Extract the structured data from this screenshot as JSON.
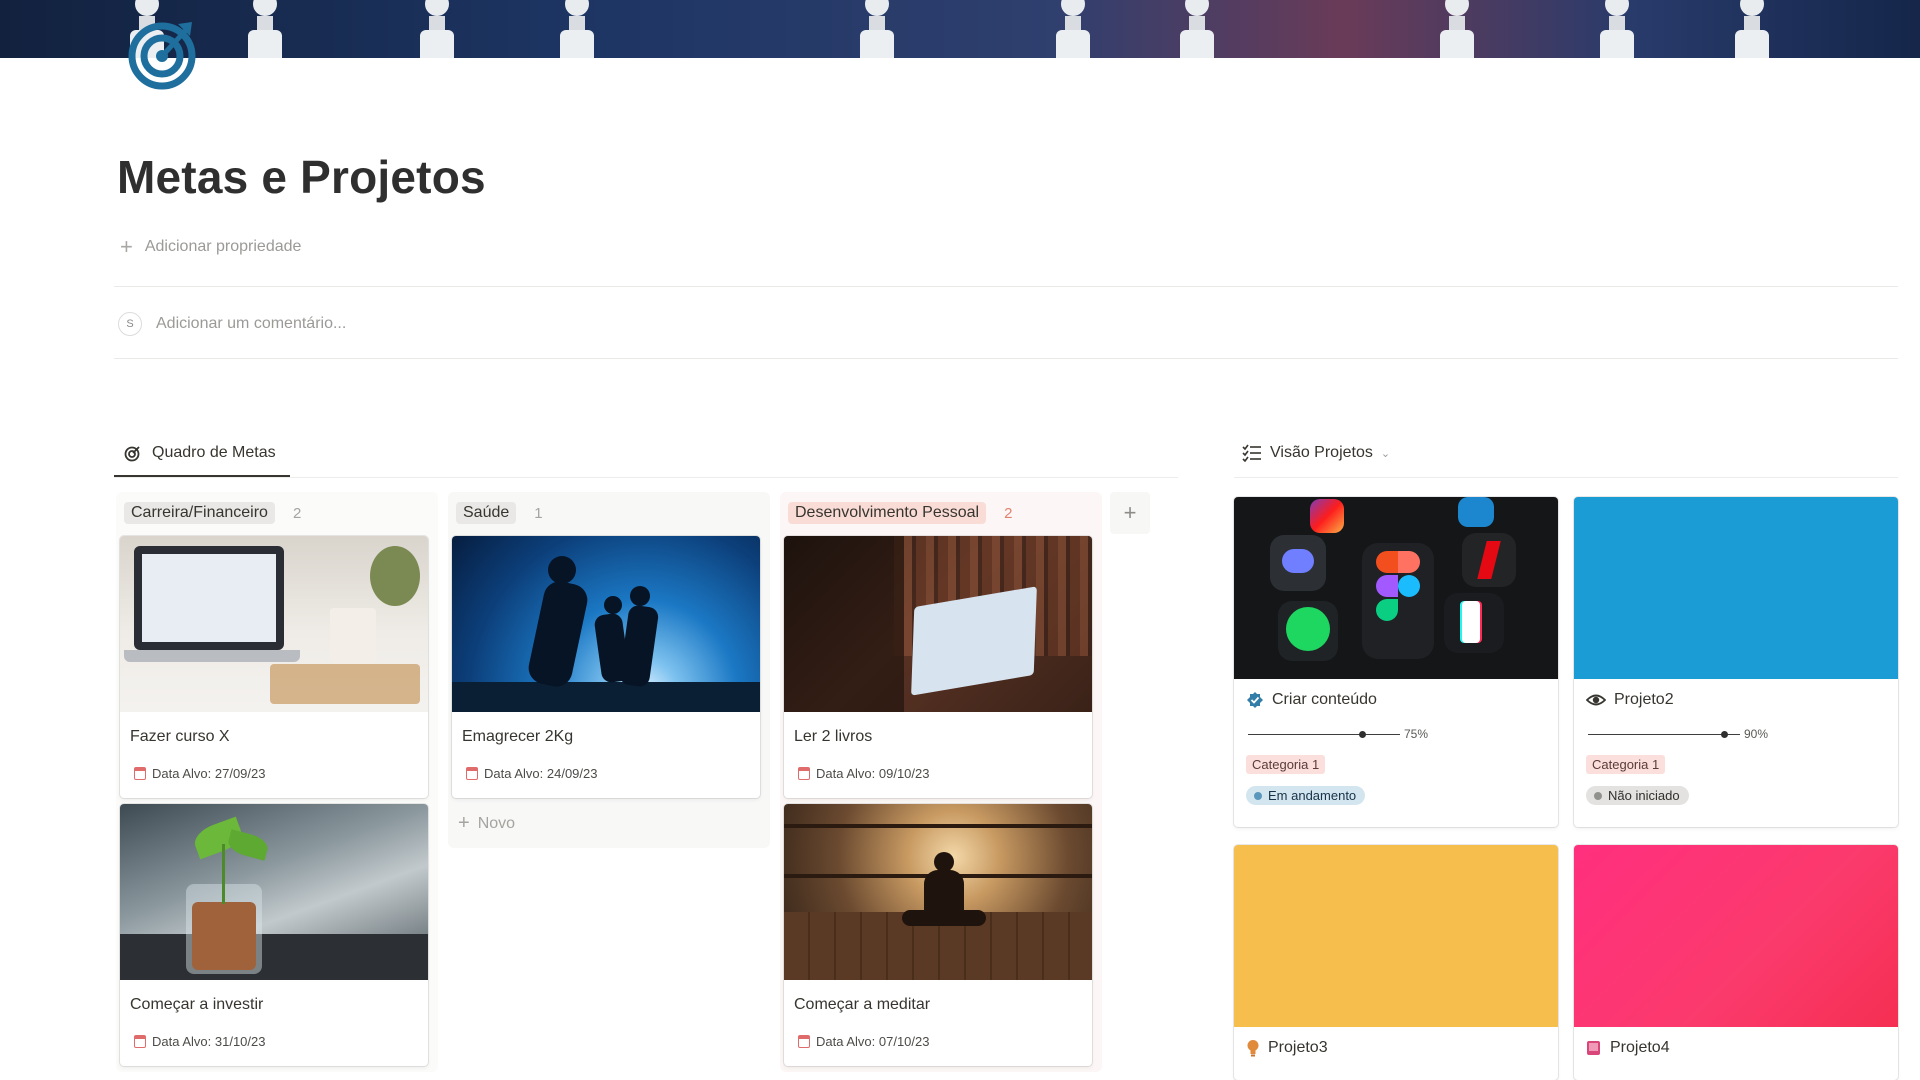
{
  "page": {
    "title": "Metas e Projetos",
    "add_property": "Adicionar propriedade",
    "comment_placeholder": "Adicionar um comentário...",
    "comment_avatar": "S"
  },
  "board": {
    "view_name": "Quadro de Metas",
    "new_label": "Novo",
    "add_group_label": "+",
    "groups": [
      {
        "name": "Carreira/Financeiro",
        "count": "2",
        "tag_color": "#e9e8e6",
        "cards": [
          {
            "title": "Fazer curso X",
            "date": "Data Alvo: 27/09/23"
          },
          {
            "title": "Começar a investir",
            "date": "Data Alvo: 31/10/23"
          }
        ]
      },
      {
        "name": "Saúde",
        "count": "1",
        "tag_color": "#e9e8e6",
        "cards": [
          {
            "title": "Emagrecer 2Kg",
            "date": "Data Alvo: 24/09/23"
          }
        ]
      },
      {
        "name": "Desenvolvimento Pessoal",
        "count": "2",
        "tag_color": "#fadcd7",
        "cards": [
          {
            "title": "Ler 2 livros",
            "date": "Data Alvo: 09/10/23"
          },
          {
            "title": "Começar a meditar",
            "date": "Data Alvo: 07/10/23"
          }
        ]
      }
    ]
  },
  "gallery": {
    "view_name": "Visão Projetos",
    "projects": [
      {
        "name": "Criar conteúdo",
        "progress": 0.75,
        "progress_label": "75%",
        "category": "Categoria 1",
        "status": "Em andamento",
        "status_color": "#d3e5ef",
        "status_dot": "#5b97bd",
        "cover": "app-icons"
      },
      {
        "name": "Projeto2",
        "progress": 0.9,
        "progress_label": "90%",
        "category": "Categoria 1",
        "status": "Não iniciado",
        "status_color": "#e3e2e0",
        "status_dot": "#91918e",
        "cover": "#1c9cd4"
      },
      {
        "name": "Projeto3",
        "cover": "#f6bf4d"
      },
      {
        "name": "Projeto4",
        "cover": "#fb3a6c"
      }
    ]
  },
  "colors": {
    "accent_blue": "#1f6f9e",
    "text": "#37352f"
  }
}
